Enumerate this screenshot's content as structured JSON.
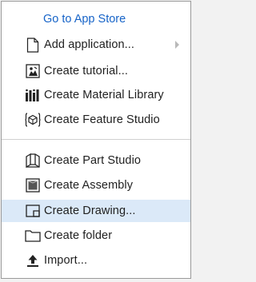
{
  "menu": {
    "store_link": "Go to App Store",
    "items": [
      {
        "label": "Add application...",
        "icon": "document-icon",
        "has_submenu": true
      },
      {
        "label": "Create tutorial...",
        "icon": "tutorial-icon"
      },
      {
        "label": "Create Material Library",
        "icon": "material-library-icon"
      },
      {
        "label": "Create Feature Studio",
        "icon": "feature-studio-icon"
      },
      {
        "label": "Create Part Studio",
        "icon": "part-studio-icon"
      },
      {
        "label": "Create Assembly",
        "icon": "assembly-icon"
      },
      {
        "label": "Create Drawing...",
        "icon": "drawing-icon",
        "highlighted": true
      },
      {
        "label": "Create folder",
        "icon": "folder-icon"
      },
      {
        "label": "Import...",
        "icon": "import-icon"
      }
    ]
  },
  "colors": {
    "link": "#1764c8",
    "highlight": "#dbe9f8",
    "text": "#1f1f1f"
  }
}
